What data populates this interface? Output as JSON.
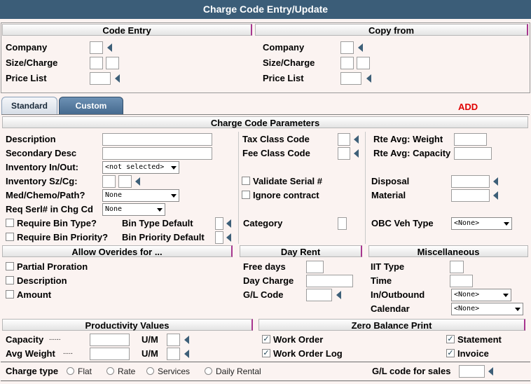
{
  "window": {
    "title": "Charge Code Entry/Update"
  },
  "code_entry": {
    "header": "Code Entry",
    "company_label": "Company",
    "size_charge_label": "Size/Charge",
    "price_list_label": "Price List"
  },
  "copy_from": {
    "header": "Copy from",
    "company_label": "Company",
    "size_charge_label": "Size/Charge",
    "price_list_label": "Price List"
  },
  "tabs": [
    {
      "label": "Standard",
      "active": true
    },
    {
      "label": "Custom",
      "active": false
    }
  ],
  "mode_status": "ADD",
  "params": {
    "header": "Charge Code Parameters",
    "description_label": "Description",
    "secondary_desc_label": "Secondary Desc",
    "inventory_inout_label": "Inventory In/Out:",
    "inventory_inout_value": "<not selected>",
    "inventory_szcg_label": "Inventory Sz/Cg:",
    "med_chemo_label": "Med/Chemo/Path?",
    "med_chemo_value": "None",
    "req_serl_label": "Req Serl# in Chg Cd",
    "req_serl_value": "None",
    "require_bin_type_label": "Require Bin Type?",
    "bin_type_default_label": "Bin Type Default",
    "require_bin_priority_label": "Require Bin Priority?",
    "bin_priority_default_label": "Bin Priority Default",
    "tax_class_label": "Tax Class Code",
    "fee_class_label": "Fee Class Code",
    "validate_serial_label": "Validate Serial #",
    "ignore_contract_label": "Ignore contract",
    "category_label": "Category",
    "rte_avg_weight_label": "Rte Avg: Weight",
    "rte_avg_capacity_label": "Rte Avg: Capacity",
    "disposal_label": "Disposal",
    "material_label": "Material",
    "obc_veh_type_label": "OBC Veh Type",
    "obc_veh_type_value": "<None>"
  },
  "overrides": {
    "header": "Allow Overides for ...",
    "partial_proration_label": "Partial Proration",
    "description_label": "Description",
    "amount_label": "Amount"
  },
  "day_rent": {
    "header": "Day Rent",
    "free_days_label": "Free days",
    "day_charge_label": "Day Charge",
    "gl_code_label": "G/L Code"
  },
  "misc": {
    "header": "Miscellaneous",
    "iit_type_label": "IIT Type",
    "time_label": "Time",
    "inoutbound_label": "In/Outbound",
    "inoutbound_value": "<None>",
    "calendar_label": "Calendar",
    "calendar_value": "<None>"
  },
  "productivity": {
    "header": "Productivity Values",
    "capacity_label": "Capacity",
    "capacity_dots": "......",
    "avg_weight_label": "Avg Weight",
    "avg_weight_dots": ".....",
    "um_label": "U/M",
    "um_label2": "U/M"
  },
  "zero_balance": {
    "header": "Zero Balance Print",
    "work_order_label": "Work Order",
    "work_order_checked": true,
    "work_order_log_label": "Work Order Log",
    "work_order_log_checked": true,
    "statement_label": "Statement",
    "statement_checked": true,
    "invoice_label": "Invoice",
    "invoice_checked": true
  },
  "charge_type": {
    "label": "Charge type",
    "options": [
      "Flat",
      "Rate",
      "Services",
      "Daily Rental"
    ],
    "gl_sales_label": "G/L code for sales"
  },
  "colors": {
    "titlebar": "#3b5d78",
    "accent_border": "#a8368f",
    "add_status": "#e00000",
    "tab_custom": "#4d7296"
  }
}
